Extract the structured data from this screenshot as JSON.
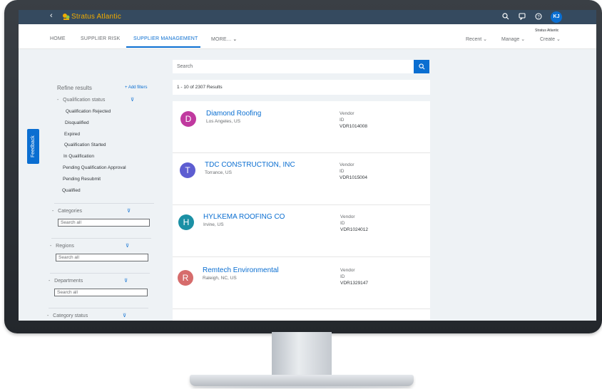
{
  "shell": {
    "back": "‹",
    "company": "Stratus Atlantic",
    "company_small": "Stratus Atlantic",
    "avatar": "KJ",
    "icons": [
      "search-icon",
      "chat-icon",
      "help-icon"
    ]
  },
  "nav": {
    "tabs": [
      "HOME",
      "SUPPLIER RISK",
      "SUPPLIER MANAGEMENT",
      "MORE..."
    ],
    "more_chevron": "⌄",
    "right": [
      "Recent",
      "Manage",
      "Create"
    ]
  },
  "sidebar": {
    "refine": "Refine results",
    "add_filters": "+ Add filters",
    "feedback": "Feedback",
    "qualification_status": {
      "label": "Qualification status",
      "items": [
        "Qualification Rejected",
        "Disqualified",
        "Expired",
        "Qualification Started",
        "In Qualification",
        "Pending Qualification Approval",
        "Pending Resubmit",
        "Qualified"
      ]
    },
    "categories": {
      "label": "Categories",
      "placeholder": "Search all"
    },
    "regions": {
      "label": "Regions",
      "placeholder": "Search all"
    },
    "departments": {
      "label": "Departments",
      "placeholder": "Search all"
    },
    "category_status": {
      "label": "Category status"
    }
  },
  "main": {
    "search_placeholder": "Search",
    "results": "1 - 10 of 2307 Results",
    "cards": [
      {
        "initial": "D",
        "name": "Diamond Roofing",
        "location": "Los Angeles, US",
        "type": "Vendor",
        "id_label": "ID",
        "id": "VDR1014008",
        "color": "#c0399f"
      },
      {
        "initial": "T",
        "name": "TDC CONSTRUCTION, INC",
        "location": "Torrance, US",
        "type": "Vendor",
        "id_label": "ID",
        "id": "VDR1015004",
        "color": "#5d5dd1"
      },
      {
        "initial": "H",
        "name": "HYLKEMA ROOFING CO",
        "location": "Irvine, US",
        "type": "Vendor",
        "id_label": "ID",
        "id": "VDR1024012",
        "color": "#1b90a5"
      },
      {
        "initial": "R",
        "name": "Remtech Environmental",
        "location": "Raleigh, NC, US",
        "type": "Vendor",
        "id_label": "ID",
        "id": "VDR1329147",
        "color": "#d66c6c"
      }
    ]
  },
  "colors": {
    "shell": "#354a5f",
    "accent": "#0a6ed1",
    "brand": "#f0ab00"
  }
}
